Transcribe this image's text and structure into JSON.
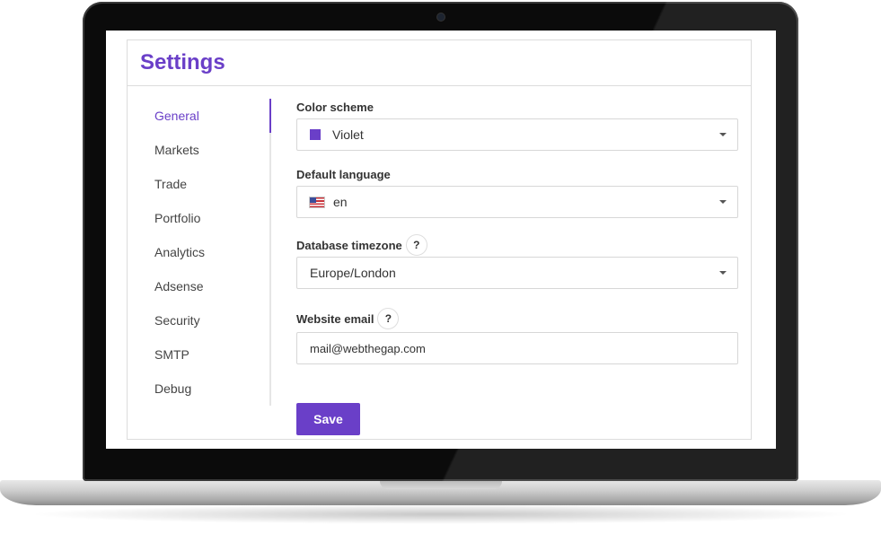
{
  "settings": {
    "title": "Settings"
  },
  "sidebar": {
    "items": [
      {
        "label": "General"
      },
      {
        "label": "Markets"
      },
      {
        "label": "Trade"
      },
      {
        "label": "Portfolio"
      },
      {
        "label": "Analytics"
      },
      {
        "label": "Adsense"
      },
      {
        "label": "Security"
      },
      {
        "label": "SMTP"
      },
      {
        "label": "Debug"
      }
    ],
    "active": "General"
  },
  "form": {
    "color_scheme": {
      "label": "Color scheme",
      "value": "Violet",
      "swatch_color": "#6a3fc8"
    },
    "default_language": {
      "label": "Default language",
      "value": "en",
      "flag_icon": "us-flag-icon"
    },
    "database_timezone": {
      "label": "Database timezone",
      "help": "?",
      "value": "Europe/London"
    },
    "website_email": {
      "label": "Website email",
      "help": "?",
      "value": "mail@webthegap.com"
    },
    "save_label": "Save"
  },
  "colors": {
    "accent": "#6a3fc8",
    "border": "#d7d7d7"
  }
}
